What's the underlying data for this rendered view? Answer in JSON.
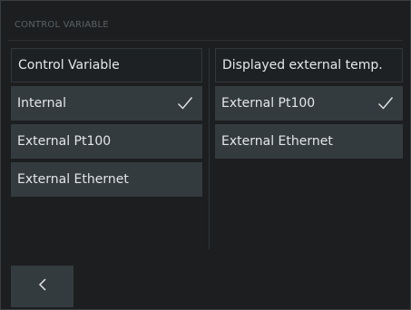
{
  "header": {
    "title": "CONTROL VARIABLE"
  },
  "left_panel": {
    "title": "Control Variable",
    "options": [
      {
        "label": "Internal",
        "selected": true
      },
      {
        "label": "External Pt100",
        "selected": false
      },
      {
        "label": "External Ethernet",
        "selected": false
      }
    ]
  },
  "right_panel": {
    "title": "Displayed external temp.",
    "options": [
      {
        "label": "External Pt100",
        "selected": true
      },
      {
        "label": "External Ethernet",
        "selected": false
      }
    ]
  },
  "icons": {
    "selected": "checkmark-icon",
    "back": "chevron-left-icon"
  },
  "colors": {
    "background": "#1c1e20",
    "option_bg": "#343b3f",
    "text": "#e3e6e7",
    "header_text": "#5a6267"
  }
}
